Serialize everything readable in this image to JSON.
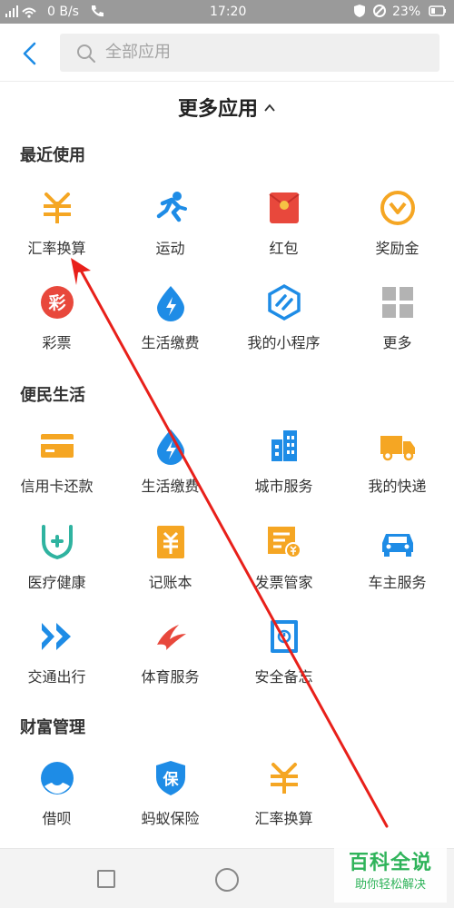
{
  "status_bar": {
    "network": "0 B/s",
    "time": "17:20",
    "battery": "23%"
  },
  "search": {
    "placeholder": "全部应用"
  },
  "more_title": "更多应用",
  "sections": {
    "recent": {
      "title": "最近使用",
      "items": [
        {
          "label": "汇率换算",
          "icon": "exchange-rate-icon"
        },
        {
          "label": "运动",
          "icon": "running-icon"
        },
        {
          "label": "红包",
          "icon": "red-envelope-icon"
        },
        {
          "label": "奖励金",
          "icon": "reward-icon"
        },
        {
          "label": "彩票",
          "icon": "lottery-icon",
          "glyph": "彩"
        },
        {
          "label": "生活缴费",
          "icon": "utility-payment-icon"
        },
        {
          "label": "我的小程序",
          "icon": "mini-program-icon"
        },
        {
          "label": "更多",
          "icon": "more-grid-icon"
        }
      ]
    },
    "convenience": {
      "title": "便民生活",
      "items": [
        {
          "label": "信用卡还款",
          "icon": "credit-card-icon"
        },
        {
          "label": "生活缴费",
          "icon": "utility-payment-icon"
        },
        {
          "label": "城市服务",
          "icon": "city-service-icon"
        },
        {
          "label": "我的快递",
          "icon": "delivery-truck-icon"
        },
        {
          "label": "医疗健康",
          "icon": "medical-health-icon"
        },
        {
          "label": "记账本",
          "icon": "account-book-icon"
        },
        {
          "label": "发票管家",
          "icon": "invoice-icon"
        },
        {
          "label": "车主服务",
          "icon": "car-owner-icon"
        },
        {
          "label": "交通出行",
          "icon": "transport-icon"
        },
        {
          "label": "体育服务",
          "icon": "sports-icon"
        },
        {
          "label": "安全备忘",
          "icon": "safe-memo-icon"
        }
      ]
    },
    "wealth": {
      "title": "财富管理",
      "items": [
        {
          "label": "借呗",
          "icon": "jiebei-icon"
        },
        {
          "label": "蚂蚁保险",
          "icon": "insurance-shield-icon",
          "glyph": "保"
        },
        {
          "label": "汇率换算",
          "icon": "exchange-rate-icon"
        }
      ]
    }
  },
  "watermark": {
    "main": "百科全说",
    "sub": "助你轻松解决"
  },
  "colors": {
    "orange": "#f5a623",
    "blue": "#1e8ce6",
    "red": "#e8483c",
    "arrow": "#e8201a",
    "watermark_green": "#2fb35a"
  }
}
